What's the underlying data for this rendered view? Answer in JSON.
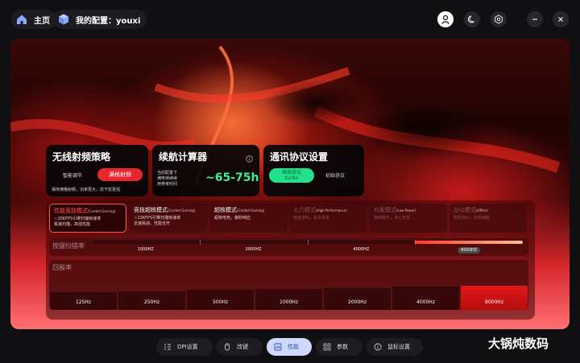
{
  "header": {
    "home_label": "主页",
    "profile_label": "我的配置：youxi"
  },
  "cards": {
    "strategy": {
      "title": "无线射频策略",
      "option_smart": "智能调节",
      "option_full": "满格射频",
      "desc": "保持满格射频，功率更大，抗干扰更强"
    },
    "battery": {
      "title": "续航计算器",
      "info_icon": "info-icon",
      "note_lines": [
        "当前配置下",
        "满电待续续",
        "用参考时间"
      ],
      "estimate": "~65-75h"
    },
    "protocol": {
      "title": "通讯协议设置",
      "option_efficient": "高效协议",
      "option_efficient_sub": "turbo",
      "option_initial": "初始协议"
    }
  },
  "modes": [
    {
      "title": "性能竞技模式",
      "sub": "(Corded Gaming)",
      "lines": [
        "☆20KFPS引擎扫描帧速率",
        "极速扫描，高强性能"
      ],
      "state": "active"
    },
    {
      "title": "竞技超核模式",
      "sub": "(Corded Gaming)",
      "lines": [
        "☆13KFPS引擎扫描帧速率",
        "全速挑战，性能全开"
      ],
      "state": "normal"
    },
    {
      "title": "超核模式",
      "sub": "(Corded Gaming)",
      "lines": [
        "超核电竞，傲秒响应"
      ],
      "state": "normal"
    },
    {
      "title": "火力模式",
      "sub": "(High Performance)",
      "lines": [
        "电竞游戏，稳定发挥"
      ],
      "state": "dim"
    },
    {
      "title": "均衡模式",
      "sub": "(Low Power)",
      "lines": [
        "游戏娱乐，平心无忧"
      ],
      "state": "dim"
    },
    {
      "title": "办公模式",
      "sub": "(Office)",
      "lines": [
        "轻松办公，长效续航"
      ],
      "state": "dim"
    }
  ],
  "scan_rate": {
    "label": "按键扫描率",
    "options": [
      "1000HZ",
      "2000HZ",
      "4000HZ",
      "8000HZ"
    ],
    "selected": "8000HZ",
    "fill_start": 0.75,
    "fill_end": 1.0
  },
  "report_rate": {
    "label": "回报率",
    "options": [
      "125Hz",
      "250Hz",
      "500Hz",
      "1000Hz",
      "2000Hz",
      "4000Hz",
      "8000Hz"
    ],
    "selected": "8000Hz"
  },
  "nav": [
    {
      "label": "DPI设置",
      "icon": "dpi-icon"
    },
    {
      "label": "改键",
      "icon": "mouse-icon"
    },
    {
      "label": "性能",
      "icon": "performance-icon"
    },
    {
      "label": "参数",
      "icon": "grid-icon"
    },
    {
      "label": "鼠标设置",
      "icon": "info-icon"
    }
  ],
  "watermark": "大锅炖数码",
  "colors": {
    "accent_red": "#e8262f",
    "accent_green": "#23e18b",
    "nav_active": "#cfd9ff"
  }
}
